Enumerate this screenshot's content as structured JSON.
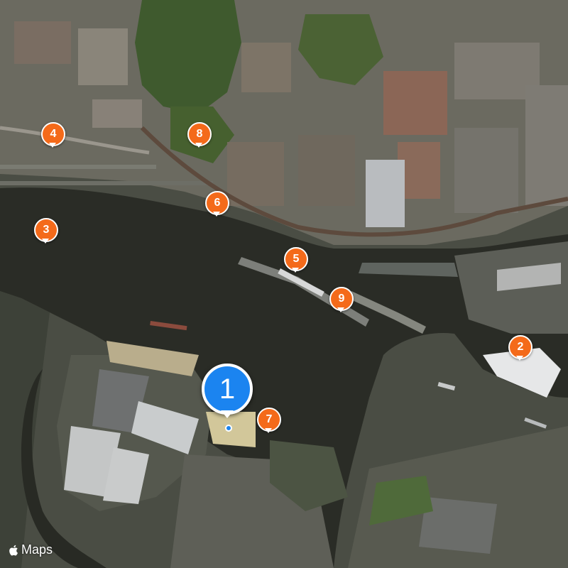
{
  "map": {
    "type": "satellite",
    "attribution": {
      "logo_icon": "apple-logo-icon",
      "text": "Maps"
    },
    "selected_pin": {
      "label": "1",
      "color": "#1b84f0"
    },
    "pins": [
      {
        "id": "2",
        "label": "2",
        "color": "#f46a1a"
      },
      {
        "id": "3",
        "label": "3",
        "color": "#f46a1a"
      },
      {
        "id": "4",
        "label": "4",
        "color": "#f46a1a"
      },
      {
        "id": "5",
        "label": "5",
        "color": "#f46a1a"
      },
      {
        "id": "6",
        "label": "6",
        "color": "#f46a1a"
      },
      {
        "id": "7",
        "label": "7",
        "color": "#f46a1a"
      },
      {
        "id": "8",
        "label": "8",
        "color": "#f46a1a"
      },
      {
        "id": "9",
        "label": "9",
        "color": "#f46a1a"
      }
    ]
  }
}
